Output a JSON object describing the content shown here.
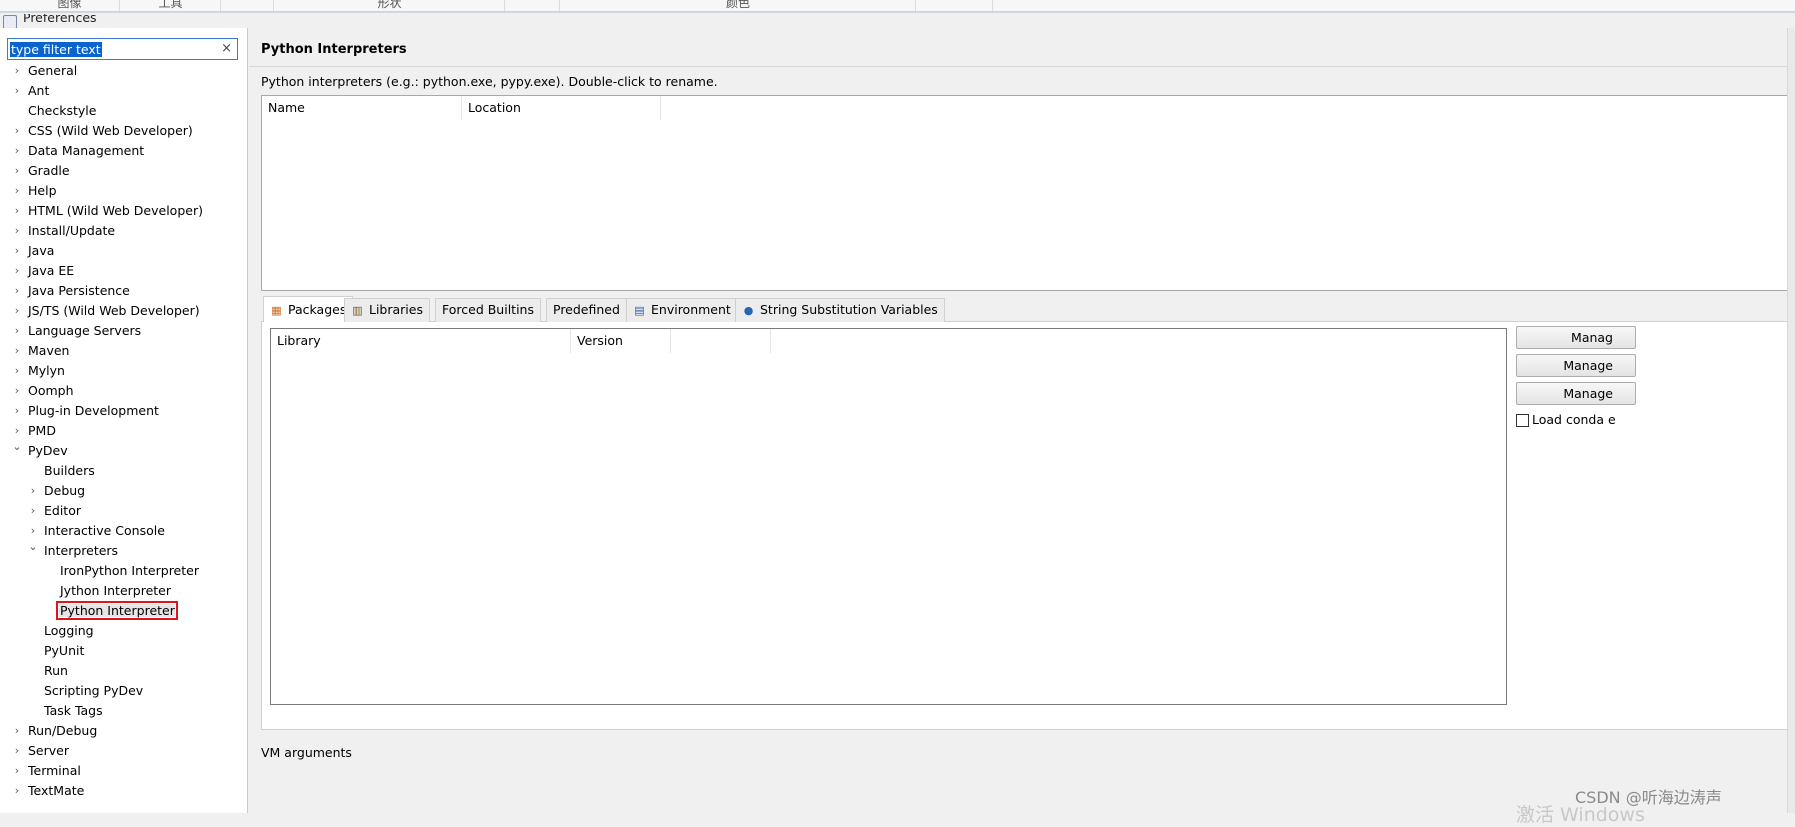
{
  "topbar": {
    "segments": [
      "图像",
      "工具",
      "",
      "形状",
      "",
      "颜色",
      ""
    ]
  },
  "window": {
    "title": "Preferences"
  },
  "filter": {
    "value": "type filter text",
    "clear_glyph": "×"
  },
  "tree": [
    {
      "label": "General",
      "level": 0,
      "expander": "collapsed"
    },
    {
      "label": "Ant",
      "level": 0,
      "expander": "collapsed"
    },
    {
      "label": "Checkstyle",
      "level": 0,
      "expander": "none"
    },
    {
      "label": "CSS (Wild Web Developer)",
      "level": 0,
      "expander": "collapsed"
    },
    {
      "label": "Data Management",
      "level": 0,
      "expander": "collapsed"
    },
    {
      "label": "Gradle",
      "level": 0,
      "expander": "collapsed"
    },
    {
      "label": "Help",
      "level": 0,
      "expander": "collapsed"
    },
    {
      "label": "HTML (Wild Web Developer)",
      "level": 0,
      "expander": "collapsed"
    },
    {
      "label": "Install/Update",
      "level": 0,
      "expander": "collapsed"
    },
    {
      "label": "Java",
      "level": 0,
      "expander": "collapsed"
    },
    {
      "label": "Java EE",
      "level": 0,
      "expander": "collapsed"
    },
    {
      "label": "Java Persistence",
      "level": 0,
      "expander": "collapsed"
    },
    {
      "label": "JS/TS (Wild Web Developer)",
      "level": 0,
      "expander": "collapsed"
    },
    {
      "label": "Language Servers",
      "level": 0,
      "expander": "collapsed"
    },
    {
      "label": "Maven",
      "level": 0,
      "expander": "collapsed"
    },
    {
      "label": "Mylyn",
      "level": 0,
      "expander": "collapsed"
    },
    {
      "label": "Oomph",
      "level": 0,
      "expander": "collapsed"
    },
    {
      "label": "Plug-in Development",
      "level": 0,
      "expander": "collapsed"
    },
    {
      "label": "PMD",
      "level": 0,
      "expander": "collapsed"
    },
    {
      "label": "PyDev",
      "level": 0,
      "expander": "expanded"
    },
    {
      "label": "Builders",
      "level": 1,
      "expander": "none"
    },
    {
      "label": "Debug",
      "level": 1,
      "expander": "collapsed"
    },
    {
      "label": "Editor",
      "level": 1,
      "expander": "collapsed"
    },
    {
      "label": "Interactive Console",
      "level": 1,
      "expander": "collapsed"
    },
    {
      "label": "Interpreters",
      "level": 1,
      "expander": "expanded"
    },
    {
      "label": "IronPython Interpreter",
      "level": 2,
      "expander": "none"
    },
    {
      "label": "Jython Interpreter",
      "level": 2,
      "expander": "none"
    },
    {
      "label": "Python Interpreter",
      "level": 2,
      "expander": "none",
      "selected": true
    },
    {
      "label": "Logging",
      "level": 1,
      "expander": "none"
    },
    {
      "label": "PyUnit",
      "level": 1,
      "expander": "none"
    },
    {
      "label": "Run",
      "level": 1,
      "expander": "none"
    },
    {
      "label": "Scripting PyDev",
      "level": 1,
      "expander": "none"
    },
    {
      "label": "Task Tags",
      "level": 1,
      "expander": "none"
    },
    {
      "label": "Run/Debug",
      "level": 0,
      "expander": "collapsed"
    },
    {
      "label": "Server",
      "level": 0,
      "expander": "collapsed"
    },
    {
      "label": "Terminal",
      "level": 0,
      "expander": "collapsed"
    },
    {
      "label": "TextMate",
      "level": 0,
      "expander": "collapsed"
    }
  ],
  "page": {
    "title": "Python Interpreters",
    "description": "Python interpreters (e.g.: python.exe, pypy.exe).   Double-click to rename.",
    "interpreter_columns": [
      "Name",
      "Location"
    ],
    "tabs": [
      {
        "label": "Packages",
        "icon": "packages-icon",
        "active": true
      },
      {
        "label": "Libraries",
        "icon": "libraries-icon",
        "active": false
      },
      {
        "label": "Forced Builtins",
        "icon": "",
        "active": false
      },
      {
        "label": "Predefined",
        "icon": "",
        "active": false
      },
      {
        "label": "Environment",
        "icon": "environment-icon",
        "active": false
      },
      {
        "label": "String Substitution Variables",
        "icon": "variables-icon",
        "active": false
      }
    ],
    "library_columns": [
      "Library",
      "Version"
    ],
    "manage_buttons": [
      "Manag",
      "Manage",
      "Manage"
    ],
    "conda_checkbox": {
      "label": "Load conda e",
      "checked": false
    },
    "vm_args_label": "VM arguments"
  },
  "watermark": {
    "text": "CSDN @听海边涛声",
    "activation": "激活 Windows"
  },
  "colors": {
    "selection": "#0a64d0",
    "highlight_border": "#e0141e"
  }
}
